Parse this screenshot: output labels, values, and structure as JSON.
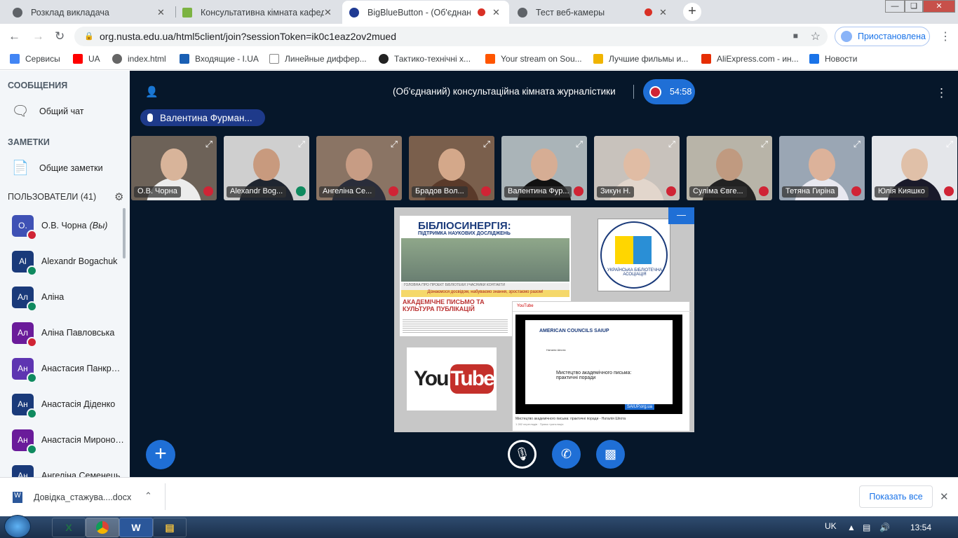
{
  "browser": {
    "tabs": [
      {
        "title": "Розклад викладача",
        "color": "#5f6368"
      },
      {
        "title": "Консультативна кімната кафедр",
        "color": "#7cb342"
      },
      {
        "title": "BigBlueButton - (Об'єднаний",
        "color": "#1f3a93"
      },
      {
        "title": "Тест веб-камеры",
        "color": "#5f6368"
      }
    ],
    "new_tab": "+",
    "close_glyph": "✕",
    "url": "org.nusta.edu.ua/html5client/join?sessionToken=ik0c1eaz2ov2mued",
    "profile_status": "Приостановлена",
    "bookmarks": [
      {
        "label": "Сервисы",
        "color": "#4285f4"
      },
      {
        "label": "UA",
        "color": "#ff0000"
      },
      {
        "label": "index.html",
        "color": "#666666"
      },
      {
        "label": "Входящие - I.UA",
        "color": "#1a5fb4"
      },
      {
        "label": "Линейные диффер...",
        "color": "#888888"
      },
      {
        "label": "Тактико-технічні х...",
        "color": "#222222"
      },
      {
        "label": "Your stream on Sou...",
        "color": "#ff5500"
      },
      {
        "label": "Лучшие фильмы и...",
        "color": "#f0b400"
      },
      {
        "label": "AliExpress.com - ин...",
        "color": "#e62e04"
      },
      {
        "label": "Новости",
        "color": "#1a73e8"
      }
    ]
  },
  "sidebar": {
    "messages_header": "СООБЩЕНИЯ",
    "public_chat": "Общий чат",
    "notes_header": "ЗАМЕТКИ",
    "shared_notes": "Общие заметки",
    "users_header": "ПОЛЬЗОВАТЕЛИ (41)",
    "users": [
      {
        "initials": "О.",
        "name": "О.В. Чорна",
        "you": "(Вы)",
        "color": "#3f51b5",
        "status": "muted"
      },
      {
        "initials": "Al",
        "name": "Alexandr Bogachuk",
        "you": "",
        "color": "#1a3a7a",
        "status": "listen"
      },
      {
        "initials": "Ал",
        "name": "Аліна",
        "you": "",
        "color": "#1a3a7a",
        "status": "listen"
      },
      {
        "initials": "Ал",
        "name": "Аліна Павловська",
        "you": "",
        "color": "#6a1b9a",
        "status": "muted"
      },
      {
        "initials": "Ан",
        "name": "Анастасия Панкратова",
        "you": "",
        "color": "#5e35b1",
        "status": "listen"
      },
      {
        "initials": "Ан",
        "name": "Анастасія Діденко",
        "you": "",
        "color": "#1a3a7a",
        "status": "listen"
      },
      {
        "initials": "Ан",
        "name": "Анастасія Миронова",
        "you": "",
        "color": "#6a1b9a",
        "status": "listen"
      },
      {
        "initials": "Ан",
        "name": "Ангеліна Семенець",
        "you": "",
        "color": "#1a3a7a",
        "status": "listen"
      }
    ]
  },
  "meeting": {
    "title": "(Об'єднаний) консультаційна кімната журналістики",
    "timer": "54:58",
    "talking": "Валентина Фурман...",
    "videos": [
      {
        "name": "О.В. Чорна",
        "status": "muted",
        "bg": "#6d6258",
        "skin": "#d8b49a",
        "shirt": "#ececec"
      },
      {
        "name": "Alexandr Bog...",
        "status": "listen",
        "bg": "#cfcfcf",
        "skin": "#c89a7e",
        "shirt": "#1f2530"
      },
      {
        "name": "Ангеліна Се...",
        "status": "muted",
        "bg": "#8a7464",
        "skin": "#c79c84",
        "shirt": "#2a2d3a"
      },
      {
        "name": "Брадов Вол...",
        "status": "muted",
        "bg": "#7a5f4c",
        "skin": "#d4a88a",
        "shirt": "#5a3a2a"
      },
      {
        "name": "Валентина Фур...",
        "status": "muted",
        "bg": "#aab4b8",
        "skin": "#d6ad94",
        "shirt": "#111111"
      },
      {
        "name": "Зикун Н.",
        "status": "muted",
        "bg": "#c8c2bc",
        "skin": "#e0bca4",
        "shirt": "#e2d6cc"
      },
      {
        "name": "Суліма Євге...",
        "status": "muted",
        "bg": "#b8b4a8",
        "skin": "#c09a80",
        "shirt": "#222222"
      },
      {
        "name": "Тетяна Гиріна",
        "status": "muted",
        "bg": "#9aa6b4",
        "skin": "#dcb29a",
        "shirt": "#e8e8f0"
      },
      {
        "name": "Юлія Кияшко",
        "status": "muted",
        "bg": "#e4e6ea",
        "skin": "#e0c0a8",
        "shirt": "#1a1a2a"
      }
    ],
    "presentation": {
      "site_title": "БІБЛІОСИНЕРГІЯ:",
      "site_subtitle": "ПІДТРИМКА НАУКОВИХ ДОСЛІДЖЕНЬ",
      "site_nav": "ГОЛОВНА ПРО ПРОЕКТ БІБЛІОТЕКИ УЧАСНИКИ КОНТАКТИ",
      "site_banner": "Дізнаємося досвідом, набуваємо знання, зростаємо разом!",
      "article_title": "АКАДЕМІЧНЕ ПИСЬМО ТА КУЛЬТУРА ПУБЛІКАЦІЙ",
      "logo_label": "УКРАЇНСЬКА БІБЛІОТЕЧНА АСОЦІАЦІЯ",
      "yt_you": "You",
      "yt_tube": "Tube",
      "yt_logo_small": "YouTube",
      "video_partners": "AMERICAN COUNCILS   SAIUP",
      "video_author": "Наталія Шпота",
      "video_slide": "Мистецтво академічного письма: практичні поради",
      "video_brand": "SAIUP.org.ua",
      "video_caption": "Мистецтво академічного письма: практичні поради - Наталія Шпота",
      "video_meta": "1 282 переглядів · Прямо трансляція"
    }
  },
  "downloads": {
    "file": "Довідка_стажува....docx",
    "show_all": "Показать все"
  },
  "taskbar": {
    "lang": "UK",
    "time": "13:54"
  }
}
